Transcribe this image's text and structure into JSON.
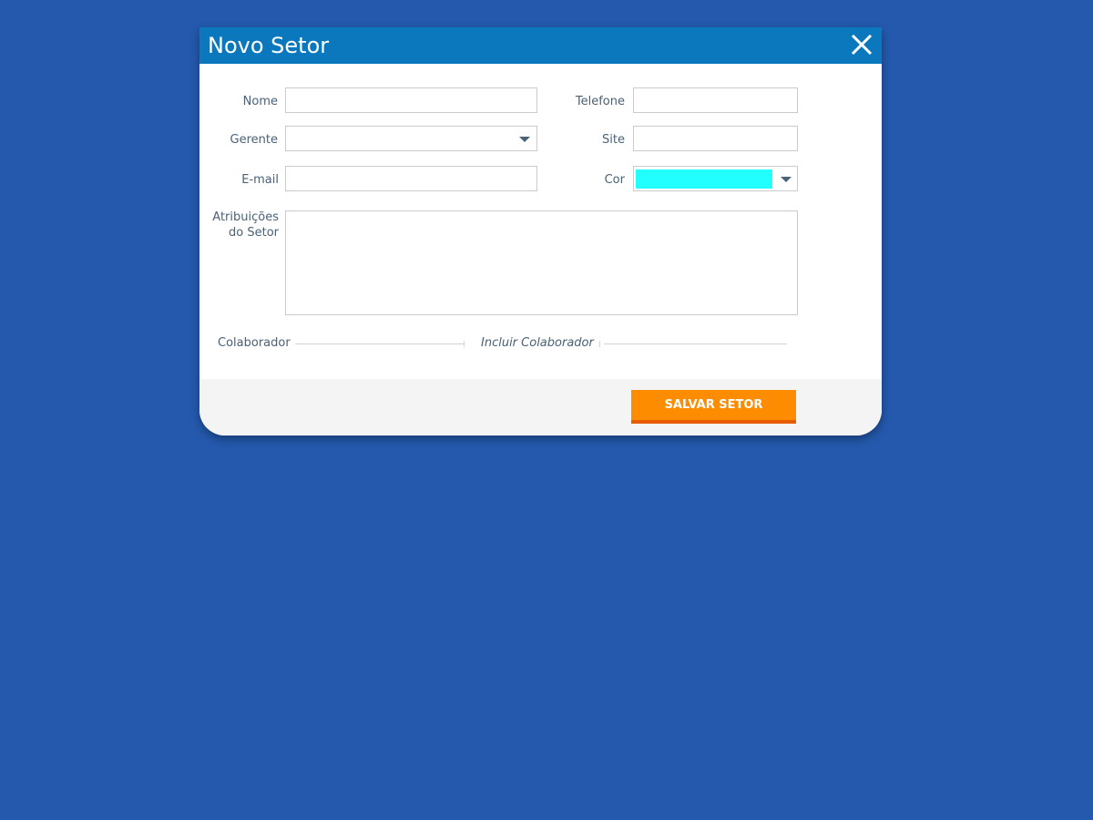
{
  "dialog": {
    "title": "Novo Setor",
    "close_icon": "close-icon"
  },
  "form": {
    "nome": {
      "label": "Nome",
      "value": ""
    },
    "telefone": {
      "label": "Telefone",
      "value": ""
    },
    "gerente": {
      "label": "Gerente",
      "value": "",
      "icon": "chevron-down-icon"
    },
    "site": {
      "label": "Site",
      "value": ""
    },
    "email": {
      "label": "E-mail",
      "value": ""
    },
    "cor": {
      "label": "Cor",
      "value_color": "#22ffff",
      "icon": "chevron-down-icon"
    },
    "atribuicoes": {
      "label_line1": "Atribuições",
      "label_line2": "do Setor",
      "value": ""
    }
  },
  "colaborador": {
    "label": "Colaborador",
    "include_link": "Incluir Colaborador"
  },
  "footer": {
    "save_label": "SALVAR SETOR"
  },
  "colors": {
    "background": "#2459ad",
    "header": "#0b77bd",
    "accent": "#fe8c00",
    "accent_border": "#e85c00",
    "label": "#4a6177"
  }
}
